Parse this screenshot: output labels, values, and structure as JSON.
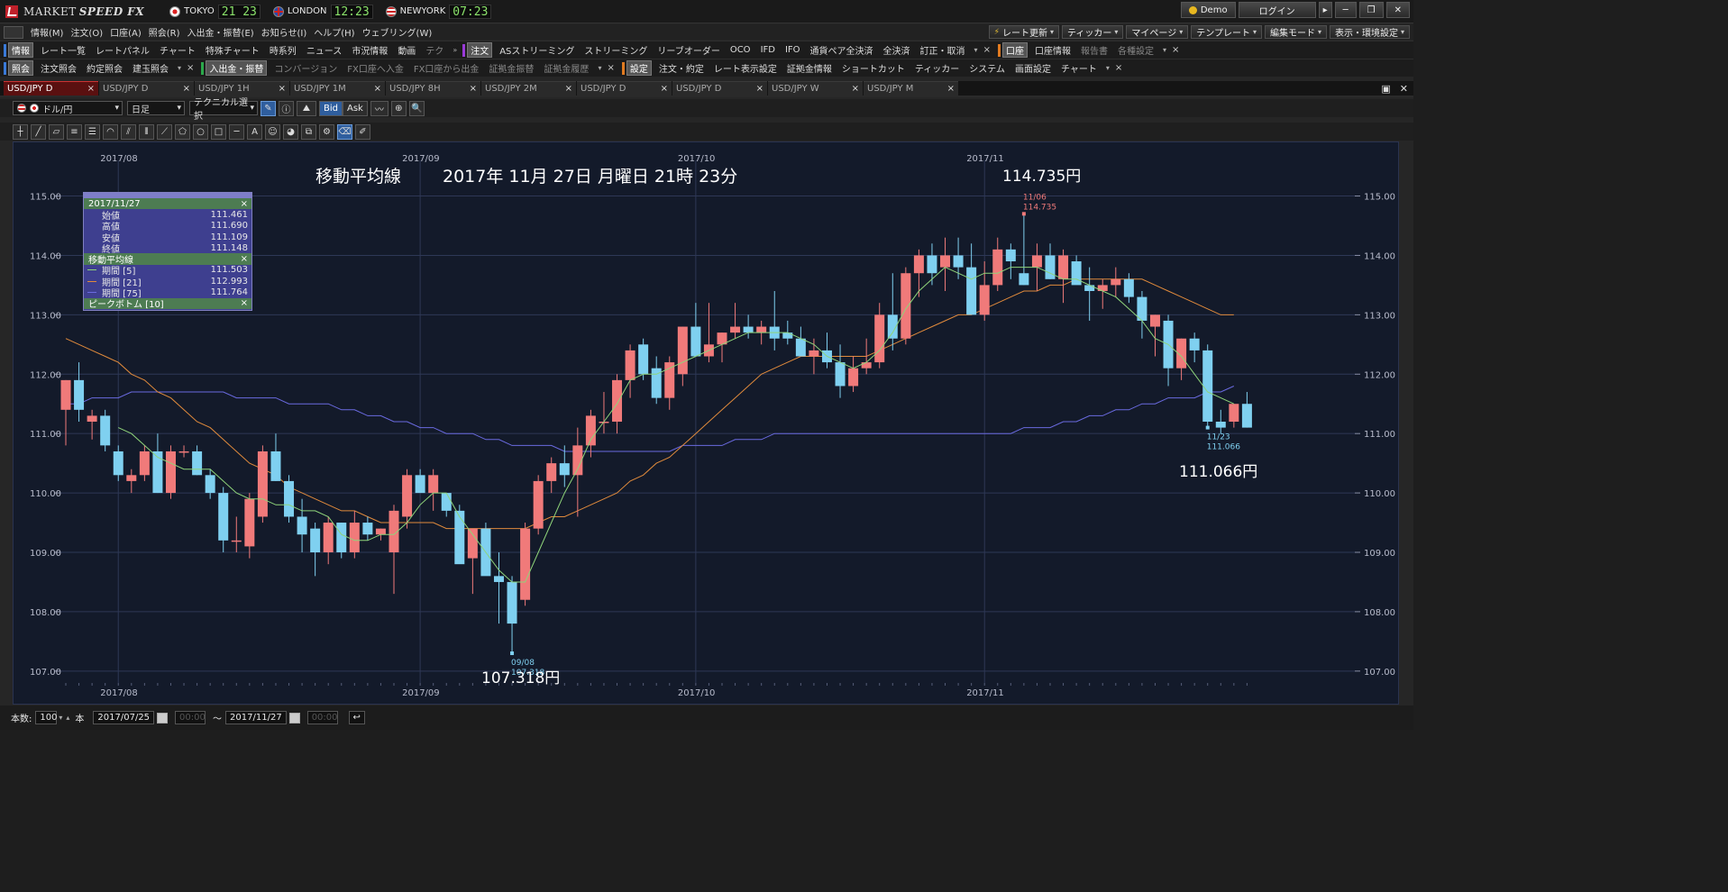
{
  "titlebar": {
    "app_name_regular": "MARKET",
    "app_name_bold": "SPEED FX",
    "clocks": [
      {
        "city": "TOKYO",
        "time": "21 23"
      },
      {
        "city": "LONDON",
        "time": "12:23"
      },
      {
        "city": "NEWYORK",
        "time": "07:23"
      }
    ],
    "demo_label": "Demo",
    "login_label": "ログイン"
  },
  "menubar": {
    "items": [
      "情報(M)",
      "注文(O)",
      "口座(A)",
      "照会(R)",
      "入出金・振替(E)",
      "お知らせ(I)",
      "ヘルプ(H)",
      "ウェブリング(W)"
    ],
    "right": [
      "レート更新",
      "ティッカー",
      "マイページ",
      "テンプレート",
      "編集モード",
      "表示・環境設定"
    ]
  },
  "toolbar_row1": {
    "info_group": [
      "情報",
      "レート一覧",
      "レートパネル",
      "チャート",
      "特殊チャート",
      "時系列",
      "ニュース",
      "市況情報",
      "動画",
      "テク"
    ],
    "order_group": [
      "注文",
      "ASストリーミング",
      "ストリーミング",
      "リーブオーダー",
      "OCO",
      "IFD",
      "IFO",
      "通貨ペア全決済",
      "全決済",
      "訂正・取消"
    ],
    "account_group": [
      "口座",
      "口座情報",
      "報告書",
      "各種設定"
    ]
  },
  "toolbar_row2": {
    "inquiry_group": [
      "照会",
      "注文照会",
      "約定照会",
      "建玉照会"
    ],
    "deposit_group": [
      "入出金・振替",
      "コンバージョン",
      "FX口座へ入金",
      "FX口座から出金",
      "証拠金振替",
      "証拠金履歴"
    ],
    "settings_group": [
      "設定",
      "注文・約定",
      "レート表示設定",
      "証拠金情報",
      "ショートカット",
      "ティッカー",
      "システム",
      "画面設定",
      "チャート"
    ]
  },
  "tabs": [
    "USD/JPY D",
    "USD/JPY D",
    "USD/JPY 1H",
    "USD/JPY 1M",
    "USD/JPY 8H",
    "USD/JPY 2M",
    "USD/JPY D",
    "USD/JPY D",
    "USD/JPY W",
    "USD/JPY M"
  ],
  "chart_toolbar": {
    "pair": "ドル/円",
    "period": "日足",
    "technical": "テクニカル選択",
    "bid": "Bid",
    "ask": "Ask"
  },
  "infobox": {
    "date": "2017/11/27",
    "ohlc": [
      {
        "label": "始値",
        "value": "111.461"
      },
      {
        "label": "高値",
        "value": "111.690"
      },
      {
        "label": "安値",
        "value": "111.109"
      },
      {
        "label": "終値",
        "value": "111.148"
      }
    ],
    "ma_title": "移動平均線",
    "ma": [
      {
        "label": "期間 [5]",
        "value": "111.503",
        "color": "#8fd47a"
      },
      {
        "label": "期間 [21]",
        "value": "112.993",
        "color": "#e08a3c"
      },
      {
        "label": "期間 [75]",
        "value": "111.764",
        "color": "#6a6ae0"
      }
    ],
    "peak_title": "ピークボトム [10]"
  },
  "overlay": {
    "heading": "移動平均線",
    "datetime": "2017年 11月 27日 月曜日 21時 23分",
    "high_big": "114.735円",
    "low_big": "107.318円",
    "recent_low_big": "111.066円"
  },
  "statusbar": {
    "count_label": "本数:",
    "count_value": "100",
    "unit": "本",
    "from_date": "2017/07/25",
    "from_time": "00:00",
    "tilde": "～",
    "to_date": "2017/11/27",
    "to_time": "00:00"
  },
  "chart_data": {
    "type": "candlestick",
    "instrument": "USD/JPY",
    "timeframe": "日足",
    "ylim": [
      106.8,
      115.6
    ],
    "yticks": [
      "115.00",
      "114.00",
      "113.00",
      "112.00",
      "111.00",
      "110.00",
      "109.00",
      "108.00",
      "107.00"
    ],
    "xticks": [
      {
        "label": "2017/08",
        "index": 4
      },
      {
        "label": "2017/09",
        "index": 27
      },
      {
        "label": "2017/10",
        "index": 48
      },
      {
        "label": "2017/11",
        "index": 70
      }
    ],
    "colors": {
      "up": "#f07a7a",
      "down": "#7fd0f0",
      "ma5": "#8fd47a",
      "ma21": "#e08a3c",
      "ma75": "#6a6ae0",
      "grid": "#2e3856"
    },
    "candles": [
      [
        111.4,
        111.9,
        110.8,
        111.9
      ],
      [
        111.9,
        112.2,
        111.2,
        111.4
      ],
      [
        111.2,
        111.4,
        110.9,
        111.3
      ],
      [
        111.3,
        111.4,
        110.7,
        110.8
      ],
      [
        110.7,
        110.8,
        110.2,
        110.3
      ],
      [
        110.2,
        110.4,
        110.0,
        110.3
      ],
      [
        110.3,
        110.8,
        110.2,
        110.7
      ],
      [
        110.7,
        111.0,
        110.0,
        110.0
      ],
      [
        110.0,
        110.8,
        109.9,
        110.7
      ],
      [
        110.7,
        110.8,
        110.6,
        110.7
      ],
      [
        110.7,
        110.8,
        110.3,
        110.3
      ],
      [
        110.3,
        110.4,
        109.9,
        110.0
      ],
      [
        110.0,
        110.1,
        109.0,
        109.2
      ],
      [
        109.2,
        109.6,
        109.0,
        109.2
      ],
      [
        109.1,
        110.0,
        108.9,
        109.9
      ],
      [
        109.6,
        110.8,
        109.5,
        110.7
      ],
      [
        110.7,
        111.0,
        110.2,
        110.2
      ],
      [
        110.2,
        110.3,
        109.5,
        109.6
      ],
      [
        109.6,
        109.9,
        109.0,
        109.3
      ],
      [
        109.4,
        109.5,
        108.6,
        109.0
      ],
      [
        109.0,
        109.6,
        108.8,
        109.5
      ],
      [
        109.5,
        109.5,
        108.9,
        109.0
      ],
      [
        109.0,
        109.7,
        108.9,
        109.5
      ],
      [
        109.5,
        109.6,
        109.2,
        109.3
      ],
      [
        109.3,
        109.4,
        109.2,
        109.4
      ],
      [
        109.0,
        109.8,
        108.3,
        109.7
      ],
      [
        109.6,
        110.4,
        109.4,
        110.3
      ],
      [
        110.3,
        110.4,
        110.0,
        110.0
      ],
      [
        110.0,
        110.4,
        109.7,
        110.3
      ],
      [
        110.0,
        110.0,
        109.6,
        109.7
      ],
      [
        109.7,
        109.8,
        108.9,
        108.8
      ],
      [
        108.9,
        109.3,
        108.3,
        109.4
      ],
      [
        109.4,
        109.5,
        108.7,
        108.6
      ],
      [
        108.6,
        109.0,
        107.8,
        108.5
      ],
      [
        108.5,
        108.6,
        107.3,
        107.8
      ],
      [
        108.2,
        109.5,
        108.1,
        109.4
      ],
      [
        109.4,
        110.3,
        109.3,
        110.2
      ],
      [
        110.2,
        110.6,
        110.0,
        110.5
      ],
      [
        110.5,
        110.8,
        110.1,
        110.3
      ],
      [
        110.3,
        111.1,
        109.6,
        110.8
      ],
      [
        110.8,
        111.4,
        110.6,
        111.3
      ],
      [
        111.2,
        111.7,
        111.0,
        111.2
      ],
      [
        111.2,
        112.0,
        111.0,
        111.9
      ],
      [
        111.9,
        112.5,
        111.6,
        112.4
      ],
      [
        112.5,
        112.6,
        111.9,
        112.0
      ],
      [
        112.1,
        112.3,
        111.5,
        111.6
      ],
      [
        111.6,
        112.3,
        111.4,
        112.2
      ],
      [
        112.0,
        112.8,
        111.8,
        112.8
      ],
      [
        112.8,
        113.2,
        112.4,
        112.3
      ],
      [
        112.3,
        113.2,
        112.2,
        112.5
      ],
      [
        112.5,
        112.7,
        112.2,
        112.7
      ],
      [
        112.7,
        113.2,
        112.6,
        112.8
      ],
      [
        112.8,
        113.0,
        112.6,
        112.7
      ],
      [
        112.7,
        112.9,
        112.5,
        112.8
      ],
      [
        112.8,
        113.4,
        112.4,
        112.6
      ],
      [
        112.7,
        112.9,
        112.5,
        112.6
      ],
      [
        112.6,
        112.8,
        112.3,
        112.3
      ],
      [
        112.3,
        112.6,
        112.0,
        112.4
      ],
      [
        112.4,
        112.7,
        112.1,
        112.2
      ],
      [
        112.2,
        112.5,
        111.6,
        111.8
      ],
      [
        111.8,
        112.3,
        111.7,
        112.1
      ],
      [
        112.1,
        112.6,
        112.0,
        112.2
      ],
      [
        112.2,
        113.2,
        112.1,
        113.0
      ],
      [
        113.0,
        113.7,
        112.4,
        112.6
      ],
      [
        112.6,
        113.8,
        112.5,
        113.7
      ],
      [
        113.7,
        114.1,
        113.3,
        114.0
      ],
      [
        114.0,
        114.2,
        113.5,
        113.7
      ],
      [
        113.8,
        114.3,
        113.4,
        114.0
      ],
      [
        114.0,
        114.3,
        113.6,
        113.8
      ],
      [
        113.8,
        114.2,
        113.1,
        113.0
      ],
      [
        113.0,
        113.9,
        112.9,
        113.5
      ],
      [
        113.5,
        114.3,
        113.4,
        114.1
      ],
      [
        114.1,
        114.2,
        113.6,
        113.9
      ],
      [
        113.7,
        114.7,
        113.5,
        113.5
      ],
      [
        113.8,
        114.2,
        113.4,
        114.0
      ],
      [
        114.0,
        114.2,
        113.6,
        113.6
      ],
      [
        113.6,
        114.1,
        113.2,
        114.0
      ],
      [
        113.9,
        114.0,
        113.6,
        113.5
      ],
      [
        113.5,
        113.8,
        112.9,
        113.4
      ],
      [
        113.4,
        113.6,
        113.1,
        113.5
      ],
      [
        113.5,
        113.8,
        113.3,
        113.6
      ],
      [
        113.6,
        113.7,
        113.2,
        113.3
      ],
      [
        113.3,
        113.4,
        112.6,
        112.9
      ],
      [
        112.8,
        113.0,
        112.3,
        113.0
      ],
      [
        112.9,
        113.0,
        111.8,
        112.1
      ],
      [
        112.1,
        112.6,
        111.9,
        112.6
      ],
      [
        112.6,
        112.7,
        112.2,
        112.4
      ],
      [
        112.4,
        112.5,
        111.1,
        111.2
      ],
      [
        111.2,
        111.4,
        111.0,
        111.1
      ],
      [
        111.2,
        111.5,
        111.1,
        111.5
      ],
      [
        111.5,
        111.7,
        111.1,
        111.1
      ]
    ],
    "ma5": [
      null,
      null,
      null,
      null,
      111.1,
      111.0,
      110.8,
      110.6,
      110.5,
      110.4,
      110.4,
      110.4,
      110.2,
      110.0,
      109.9,
      109.9,
      109.8,
      109.8,
      109.7,
      109.7,
      109.6,
      109.3,
      109.2,
      109.2,
      109.3,
      109.3,
      109.5,
      109.8,
      110.0,
      110.0,
      109.6,
      109.3,
      109.0,
      108.7,
      108.5,
      108.5,
      109.0,
      109.5,
      110.0,
      110.4,
      110.9,
      111.2,
      111.5,
      111.9,
      112.0,
      112.0,
      112.1,
      112.2,
      112.3,
      112.4,
      112.5,
      112.6,
      112.7,
      112.7,
      112.7,
      112.7,
      112.6,
      112.5,
      112.3,
      112.2,
      112.1,
      112.2,
      112.4,
      112.7,
      113.1,
      113.4,
      113.6,
      113.8,
      113.7,
      113.6,
      113.7,
      113.7,
      113.8,
      113.8,
      113.8,
      113.7,
      113.6,
      113.6,
      113.5,
      113.4,
      113.3,
      113.1,
      112.9,
      112.6,
      112.5,
      112.3,
      112.0,
      111.7,
      111.6,
      111.5
    ],
    "ma21": [
      112.6,
      112.5,
      112.4,
      112.3,
      112.2,
      112.0,
      111.9,
      111.7,
      111.6,
      111.4,
      111.2,
      111.1,
      110.9,
      110.7,
      110.5,
      110.4,
      110.3,
      110.1,
      110.0,
      109.9,
      109.8,
      109.7,
      109.7,
      109.6,
      109.5,
      109.5,
      109.5,
      109.5,
      109.5,
      109.4,
      109.4,
      109.4,
      109.4,
      109.4,
      109.4,
      109.4,
      109.5,
      109.6,
      109.6,
      109.7,
      109.8,
      109.9,
      110.0,
      110.2,
      110.3,
      110.5,
      110.6,
      110.8,
      111.0,
      111.2,
      111.4,
      111.6,
      111.8,
      112.0,
      112.1,
      112.2,
      112.3,
      112.3,
      112.3,
      112.3,
      112.3,
      112.3,
      112.4,
      112.5,
      112.6,
      112.7,
      112.8,
      112.9,
      113.0,
      113.0,
      113.1,
      113.2,
      113.3,
      113.4,
      113.4,
      113.5,
      113.5,
      113.6,
      113.6,
      113.6,
      113.6,
      113.6,
      113.6,
      113.5,
      113.4,
      113.3,
      113.2,
      113.1,
      113.0,
      113.0
    ],
    "ma75": [
      111.5,
      111.5,
      111.6,
      111.6,
      111.6,
      111.7,
      111.7,
      111.7,
      111.7,
      111.7,
      111.7,
      111.7,
      111.7,
      111.6,
      111.6,
      111.6,
      111.6,
      111.5,
      111.5,
      111.5,
      111.5,
      111.4,
      111.4,
      111.3,
      111.3,
      111.2,
      111.2,
      111.1,
      111.1,
      111.0,
      111.0,
      111.0,
      110.9,
      110.9,
      110.8,
      110.8,
      110.8,
      110.8,
      110.7,
      110.7,
      110.7,
      110.7,
      110.7,
      110.7,
      110.7,
      110.7,
      110.7,
      110.8,
      110.8,
      110.8,
      110.8,
      110.9,
      110.9,
      110.9,
      111.0,
      111.0,
      111.0,
      111.0,
      111.0,
      111.0,
      111.0,
      111.0,
      111.0,
      111.0,
      111.0,
      111.0,
      111.0,
      111.0,
      111.0,
      111.0,
      111.0,
      111.0,
      111.0,
      111.1,
      111.1,
      111.1,
      111.2,
      111.2,
      111.3,
      111.3,
      111.4,
      111.4,
      111.5,
      111.5,
      111.6,
      111.6,
      111.6,
      111.7,
      111.7,
      111.8
    ],
    "peaks": [
      {
        "index": 73,
        "date": "11/06",
        "price": "114.735",
        "kind": "high"
      },
      {
        "index": 34,
        "date": "09/08",
        "price": "107.318",
        "kind": "low"
      },
      {
        "index": 87,
        "date": "11/23",
        "price": "111.066",
        "kind": "low"
      }
    ]
  }
}
